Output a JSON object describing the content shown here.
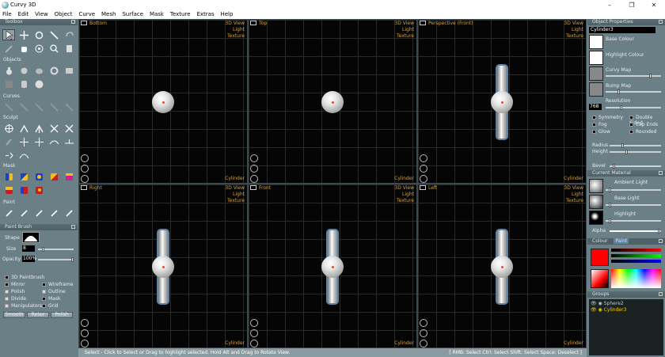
{
  "window": {
    "title": "Curvy 3D",
    "min": "–",
    "max": "❐",
    "close": "✕"
  },
  "menu": [
    "File",
    "Edit",
    "View",
    "Object",
    "Curve",
    "Mesh",
    "Surface",
    "Mask",
    "Texture",
    "Extras",
    "Help"
  ],
  "toolbox": {
    "title": "Toolbox",
    "sections": {
      "objects": "Objects",
      "curves": "Curves",
      "sculpt": "Sculpt",
      "mask": "Mask",
      "paint": "Paint"
    }
  },
  "paint_brush": {
    "title": "Paint Brush",
    "shape_label": "Shape",
    "size_label": "Size",
    "size_value": "8",
    "opacity_label": "Opacity",
    "opacity_value": "100%",
    "options_left": [
      "3D Paintbrush",
      "Mirror",
      "Polish",
      "Divide",
      "Manipulators"
    ],
    "options_right": [
      "Wireframe",
      "Outline",
      "Mask",
      "Grid"
    ],
    "buttons": [
      "Smooth",
      "Relax",
      "Polish"
    ]
  },
  "viewports": {
    "view_label": "3D View",
    "light_label": "Light",
    "texture_label": "Texture",
    "object_label": "Cylinder",
    "names": [
      "Bottom",
      "Top",
      "Perspective (Front)",
      "Right",
      "Front",
      "Left"
    ]
  },
  "object_properties": {
    "title": "Object Properties",
    "name": "Cylinder3",
    "base_colour": "Base Colour",
    "highlight_colour": "Highlight Colour",
    "curvy_map": "Curvy Map",
    "bump_map": "Bump Map",
    "resolution_label": "Resolution",
    "resolution_value": "768",
    "checks_left": [
      "Symmetry",
      "Fog",
      "Glow"
    ],
    "checks_right": [
      "Double Sided",
      "Cap Ends",
      "Rounded"
    ],
    "radius": "Radius",
    "height": "Height",
    "bevel": "Bevel"
  },
  "current_material": {
    "title": "Current Material",
    "ambient": "Ambient Light",
    "base_light": "Base Light",
    "highlight": "Highlight",
    "alpha": "Alpha"
  },
  "colour": {
    "tab_colour": "Colour",
    "tab_paint": "Paint"
  },
  "groups": {
    "title": "Groups",
    "items": [
      "Sphere2",
      "Cylinder3"
    ]
  },
  "status": {
    "left": "Select - Click to Select or Drag to highlight selected. Hold Alt and Drag to Rotate View.",
    "right": "[ RMB: Select   Ctrl: Select   Shift: Select   Space: Deselect ]"
  },
  "colors": {
    "viewport_label": "#d4a33a",
    "active_group": "#f0d000",
    "selection": "#5b84a8"
  }
}
